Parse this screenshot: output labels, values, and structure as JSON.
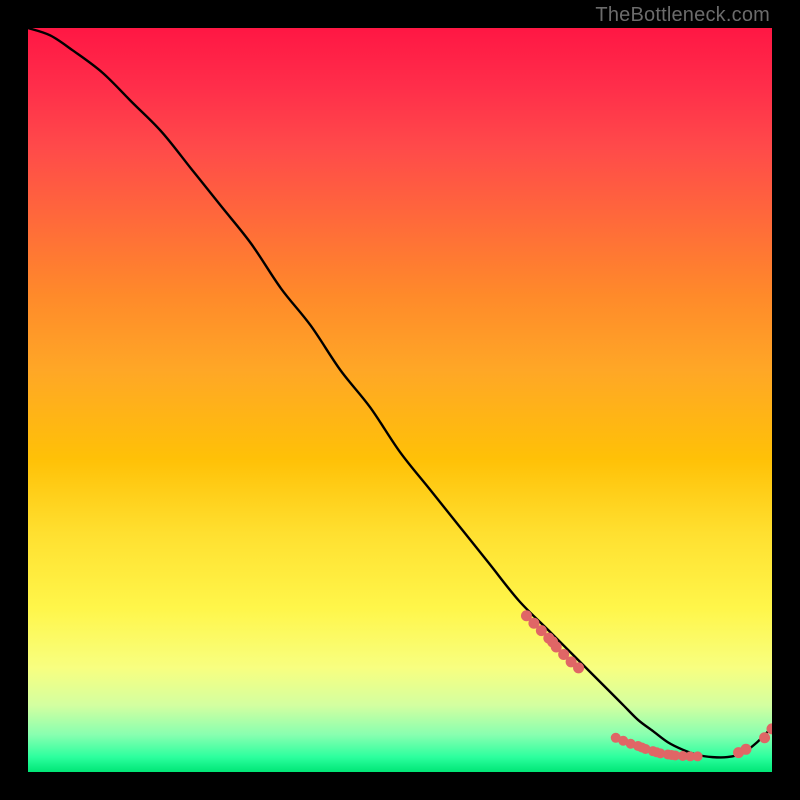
{
  "attribution": "TheBottleneck.com",
  "chart_data": {
    "type": "line",
    "title": "",
    "xlabel": "",
    "ylabel": "",
    "xlim": [
      0,
      100
    ],
    "ylim": [
      0,
      100
    ],
    "series": [
      {
        "name": "bottleneck-curve",
        "x": [
          0,
          3,
          6,
          10,
          14,
          18,
          22,
          26,
          30,
          34,
          38,
          42,
          46,
          50,
          54,
          58,
          62,
          66,
          70,
          74,
          78,
          80,
          82,
          84,
          86,
          88,
          90,
          92,
          94,
          96,
          98,
          100
        ],
        "y": [
          100,
          99,
          97,
          94,
          90,
          86,
          81,
          76,
          71,
          65,
          60,
          54,
          49,
          43,
          38,
          33,
          28,
          23,
          19,
          15,
          11,
          9,
          7,
          5.5,
          4,
          3,
          2.3,
          2,
          2,
          2.5,
          4,
          6
        ]
      }
    ],
    "markers_cluster_a": {
      "x": [
        67,
        68,
        69,
        70,
        70.5,
        71,
        72,
        73,
        74
      ],
      "y": [
        21,
        20,
        19,
        18,
        17.5,
        16.8,
        15.8,
        14.8,
        14
      ]
    },
    "markers_cluster_b": {
      "x": [
        79,
        80,
        81,
        82,
        82.5,
        83,
        84,
        84.5,
        85,
        86,
        86.5,
        87,
        88,
        89,
        90
      ],
      "y": [
        4.6,
        4.2,
        3.8,
        3.5,
        3.3,
        3.1,
        2.8,
        2.65,
        2.5,
        2.35,
        2.28,
        2.22,
        2.15,
        2.1,
        2.1
      ]
    },
    "markers_cluster_c": {
      "x": [
        95.5,
        96.5,
        99,
        100
      ],
      "y": [
        2.6,
        3.05,
        4.6,
        5.8
      ]
    }
  },
  "colors": {
    "curve": "#000000",
    "marker": "#e06666"
  }
}
